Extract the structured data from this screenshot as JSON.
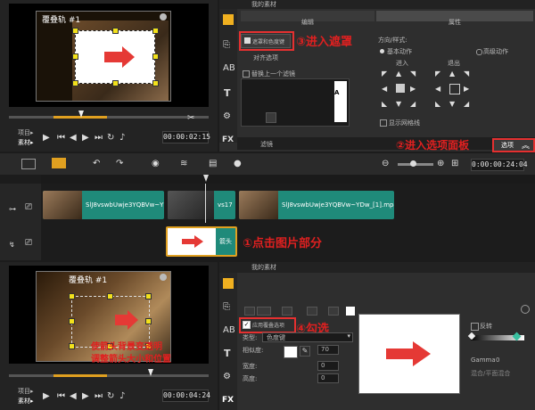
{
  "top": {
    "preview_caption": "覆叠轨 #1",
    "project_label": "项目▸",
    "material_label": "素材▸",
    "timecode": "00:00:02:15",
    "tabs": {
      "edit": "编辑",
      "properties": "属性"
    },
    "mask_button": "遮罩和色度键",
    "align_option": "对齐选项",
    "replace_last_filter": "替换上一个滤镜",
    "direction_style": "方向/样式:",
    "enter_label": "进入",
    "exit_label": "退出",
    "basic_action": "基本动作",
    "advanced_action": "高级动作",
    "show_grid": "显示网格线",
    "filter_label": "滤镜",
    "options_button": "选项",
    "library_dropdown": "我的素材",
    "custom_filter_letter": "A"
  },
  "timeline": {
    "timecode": "0:00:00:24:04",
    "clips": [
      {
        "label": "SlJ8vswbUwje3YQBVw~YDw_[1].mp4"
      },
      {
        "label": "vs17"
      },
      {
        "label": "SlJ8vswbUwje3YQBVw~YDw_[1].mp4"
      }
    ],
    "overlay_clip_label": "箭头"
  },
  "bottom": {
    "preview_caption": "覆叠轨 #1",
    "project_label": "项目▸",
    "material_label": "素材▸",
    "timecode": "00:00:04:24",
    "library_dropdown": "我的素材",
    "apply_overlay": "应用覆叠选项",
    "type_label": "类型:",
    "type_value": "色度键",
    "similarity_label": "相似度:",
    "similarity_value": "70",
    "width_label": "宽度:",
    "height_label": "高度:",
    "width_value": "0",
    "height_value": "0",
    "size_value": "0",
    "invert_label": "反转",
    "gamma_label": "Gamma",
    "gamma_value": "0",
    "blend_mode": "混合/平面混合"
  },
  "annotations": {
    "step1": "①点击图片部分",
    "step2": "②进入选项面板",
    "step3": "③进入遮罩",
    "step4": "④勾选",
    "note_line1": "使箭头背景变透明",
    "note_line2": "调整箭头大小和位置"
  },
  "colors": {
    "accent_orange": "#e0a020",
    "annotation_red": "#e02020",
    "clip_teal": "#1f8a7a",
    "selection_yellow": "#f3e11b",
    "arrow_red": "#e53935"
  }
}
